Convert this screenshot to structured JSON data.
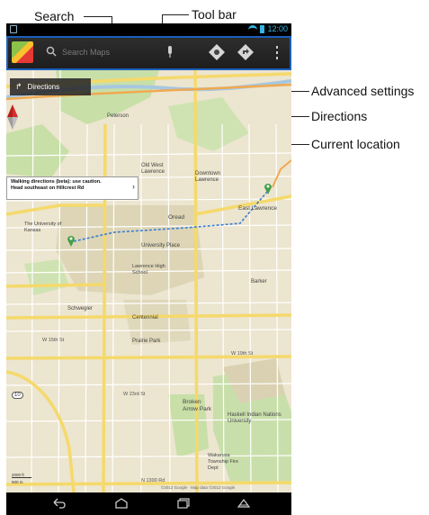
{
  "callouts": {
    "search": "Search",
    "toolbar": "Tool bar",
    "advanced_settings": "Advanced settings",
    "directions": "Directions",
    "current_location": "Current location"
  },
  "status_bar": {
    "time": "12:00"
  },
  "toolbar": {
    "search_placeholder": "Search Maps"
  },
  "map": {
    "directions_chip": "Directions",
    "walking_bubble": {
      "line1": "Walking directions (beta): use caution.",
      "line2": "Head southeast on Hillcrest Rd"
    },
    "labels": {
      "peterson": "Peterson",
      "old_west_lawrence": "Old West Lawrence",
      "downtown": "Downtown Lawrence",
      "east_lawrence": "East Lawrence",
      "oread": "Oread",
      "university_of_kansas": "The University of Kansas",
      "university_place": "University Place",
      "lawrence_high": "Lawrence High School",
      "barker": "Barker",
      "schwegler": "Schwegler",
      "centennial": "Centennial",
      "prairie_park": "Prairie Park",
      "broken_arrow_park": "Broken Arrow Park",
      "haskell": "Haskell Indian Nations University",
      "wakarusa": "Wakarusa Township Fire Dept",
      "w15th": "W 15th St",
      "w19th": "W 19th St",
      "w23rd": "W 23rd St",
      "n1300": "N 1300 Rd",
      "route10": "10",
      "copyright": "©2012 Google · Map data ©2012 Google",
      "scale1": "2000 ft",
      "scale2": "500 m"
    }
  },
  "colors": {
    "toolbar_border": "#1b5fbd",
    "map_bg": "#ece5cf",
    "road_major": "#f5d96b",
    "park": "#c8dfa8",
    "campus": "#d9d0b0"
  }
}
